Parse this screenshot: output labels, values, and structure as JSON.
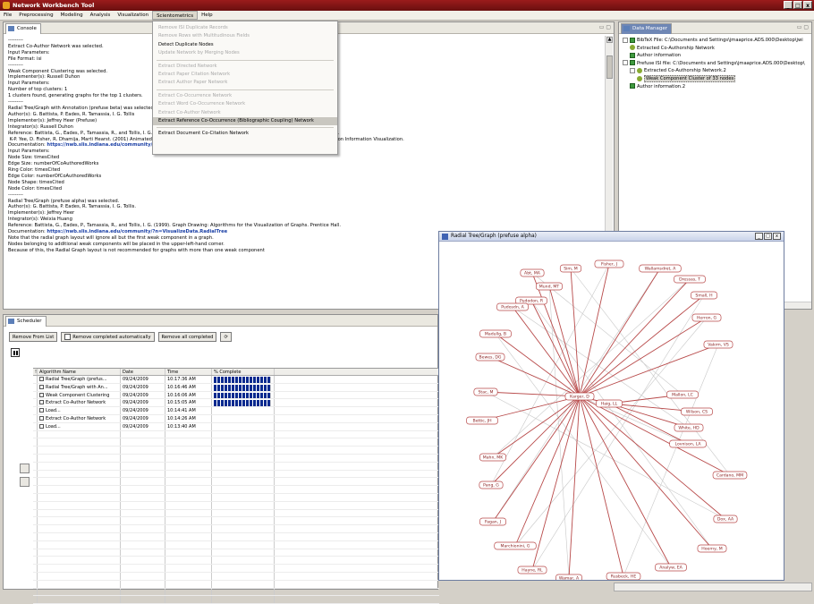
{
  "app": {
    "title": "Network Workbench Tool",
    "window_buttons": [
      "_",
      "□",
      "x"
    ]
  },
  "menu": [
    "File",
    "Preprocessing",
    "Modeling",
    "Analysis",
    "Visualization",
    "Scientometrics",
    "Help"
  ],
  "scientometrics_menu": [
    {
      "label": "Remove ISI Duplicate Records",
      "enabled": false
    },
    {
      "label": "Remove Rows with Multitudinous Fields",
      "enabled": false
    },
    {
      "label": "Detect Duplicate Nodes",
      "enabled": true
    },
    {
      "label": "Update Network by Merging Nodes",
      "enabled": false
    },
    {
      "sep": true
    },
    {
      "label": "Extract Directed Network",
      "enabled": false
    },
    {
      "label": "Extract Paper Citation Network",
      "enabled": false
    },
    {
      "label": "Extract Author Paper Network",
      "enabled": false
    },
    {
      "sep": true
    },
    {
      "label": "Extract Co-Occurrence Network",
      "enabled": false
    },
    {
      "label": "Extract Word Co-Occurrence Network",
      "enabled": false
    },
    {
      "label": "Extract Co-Author Network",
      "enabled": false
    },
    {
      "label": "Extract Reference Co-Occurrence (Bibliographic Coupling) Network",
      "enabled": true,
      "highlight": true
    },
    {
      "sep": true
    },
    {
      "label": "Extract Document Co-Citation Network",
      "enabled": true
    }
  ],
  "console": {
    "tab": "Console",
    "lines": [
      {
        "t": "---------"
      },
      {
        "t": "Extract Co-Author Network was selected."
      },
      {
        "t": ""
      },
      {
        "t": "Input Parameters:"
      },
      {
        "t": "File Format: isi"
      },
      {
        "t": "---------"
      },
      {
        "t": "Weak Component Clustering was selected."
      },
      {
        "t": "Implementer(s): Russell Duhon"
      },
      {
        "t": ""
      },
      {
        "t": "Input Parameters:"
      },
      {
        "t": "Number of top clusters: 1"
      },
      {
        "t": "1 clusters found, generating graphs for the top 1 clusters."
      },
      {
        "t": "---------"
      },
      {
        "t": "Radial Tree/Graph with Annotation (prefuse beta) was selected."
      },
      {
        "t": "Author(s): G. Battista, P. Eades, R. Tamassia, I. G. Tollis"
      },
      {
        "t": "Implementer(s): Jeffrey Heer (Prefuse)"
      },
      {
        "t": "Integrator(s): Russell Duhon"
      },
      {
        "t": "Reference: Battista, G., Eades, P., Tamassia, R., and Tollis, I. G. (1998) Graph Drawing: Algorithms for the Visualization of Graphs. Prentice Hall."
      },
      {
        "t": " K-P. Yee, D. Fisher, R. Dhamija, Marti Hearst. (2001) Animated Exploration of Graphs with Radial Layout.  Proceedings of the IEEE Symposium on Information Visualization."
      },
      {
        "t": "Documentation: ",
        "link": "https://nwb.slis.indiana.edu/community/?n=VisualizeData.RadialTree"
      },
      {
        "t": ""
      },
      {
        "t": "Input Parameters:"
      },
      {
        "t": "Node Size: timesCited"
      },
      {
        "t": "Edge Size: numberOfCoAuthoredWorks"
      },
      {
        "t": "Ring Color: timesCited"
      },
      {
        "t": "Edge Color: numberOfCoAuthoredWorks"
      },
      {
        "t": "Node Shape: timesCited"
      },
      {
        "t": "Node Color: timesCited"
      },
      {
        "t": "---------"
      },
      {
        "t": "Radial Tree/Graph (prefuse alpha) was selected."
      },
      {
        "t": "Author(s): G. Battista, P. Eades, R. Tamassia, I. G. Tollis."
      },
      {
        "t": "Implementer(s): Jeffrey Heer"
      },
      {
        "t": "Integrator(s): Weixia Huang"
      },
      {
        "t": "Reference: Battista, G., Eades, P., Tamassia, R., and Tollis, I. G. (1999). Graph Drawing: Algorithms for the Visualization of Graphs. Prentice Hall."
      },
      {
        "t": "Documentation: ",
        "link": "https://nwb.slis.indiana.edu/community/?n=VisualizeData.RadialTree"
      },
      {
        "t": ""
      },
      {
        "t": "Note that the radial graph layout will ignore all but the first weak component in a graph."
      },
      {
        "t": "Nodes belonging to additional weak components will be placed in the upper-left-hand corner."
      },
      {
        "t": "Because of this, the Radial Graph layout is not recommended for graphs with more than one weak component"
      }
    ]
  },
  "data_manager": {
    "tab": "Data Manager",
    "tree": [
      {
        "label": "BibTeX File: C:\\Documents and Settings\\jmaaprice.ADS.000\\Desktop\\jwi",
        "icon": "tbl",
        "depth": 0,
        "toggle": "-"
      },
      {
        "label": "Extracted Co-Authorship Network",
        "icon": "net",
        "depth": 1
      },
      {
        "label": "Author information",
        "icon": "tbl",
        "depth": 1
      },
      {
        "label": "Prefuse ISI file: C:\\Documents and Settings\\jmaaprice.ADS.000\\Desktop\\",
        "icon": "tbl",
        "depth": 0,
        "toggle": "-"
      },
      {
        "label": "Extracted Co-Authorship Network.2",
        "icon": "net",
        "depth": 1,
        "toggle": "-"
      },
      {
        "label": "Weak Component Cluster of 33 nodes",
        "icon": "net",
        "depth": 2,
        "selected": true
      },
      {
        "label": "Author information.2",
        "icon": "tbl",
        "depth": 1
      }
    ]
  },
  "scheduler": {
    "tab": "Scheduler",
    "remove_from_list": "Remove From List",
    "remove_auto": "Remove completed automatically",
    "remove_all": "Remove all completed",
    "columns": [
      "!",
      "Algorithm Name",
      "Date",
      "Time",
      "% Complete"
    ],
    "rows": [
      {
        "name": "Radial Tree/Graph (prefus...",
        "date": "09/24/2009",
        "time": "10:17:36 AM"
      },
      {
        "name": "Radial Tree/Graph with An...",
        "date": "09/24/2009",
        "time": "10:16:46 AM"
      },
      {
        "name": "Weak Component Clustering",
        "date": "09/24/2009",
        "time": "10:16:06 AM"
      },
      {
        "name": "Extract Co-Author Network",
        "date": "09/24/2009",
        "time": "10:15:05 AM"
      },
      {
        "name": "Load...",
        "date": "09/24/2009",
        "time": "10:14:41 AM"
      },
      {
        "name": "Extract Co-Author Network",
        "date": "09/24/2009",
        "time": "10:14:26 AM"
      },
      {
        "name": "Load...",
        "date": "09/24/2009",
        "time": "10:13:40 AM"
      }
    ]
  },
  "radial_window": {
    "title": "Radial Tree/Graph (prefuse alpha)",
    "center": "Karger, D",
    "hub2": "Haig, LL",
    "nodes": [
      "Abt, MA",
      "Sim, M",
      "Fisher, J",
      "Wallamsdret, A",
      "Pudodon, R",
      "Mund, MT",
      "Dressas, T",
      "Small, H",
      "Pudosdn, A",
      "Herron, G",
      "Madullg, B",
      "Vakrm, VS",
      "Bewes, DG",
      "Stac, M",
      "Bettic, JH",
      "Mallon, LC",
      "Wilson, CS",
      "White, HD",
      "Lovnison, LA",
      "Mahn, MK",
      "Pang, G",
      "Cardano, MM",
      "Fagan, J",
      "Dox, AA",
      "Marchionini, G",
      "Hoerny, M",
      "Hayne, RL",
      "Analyw, EA",
      "Wamar, A",
      "Rusbeck, HE"
    ]
  }
}
